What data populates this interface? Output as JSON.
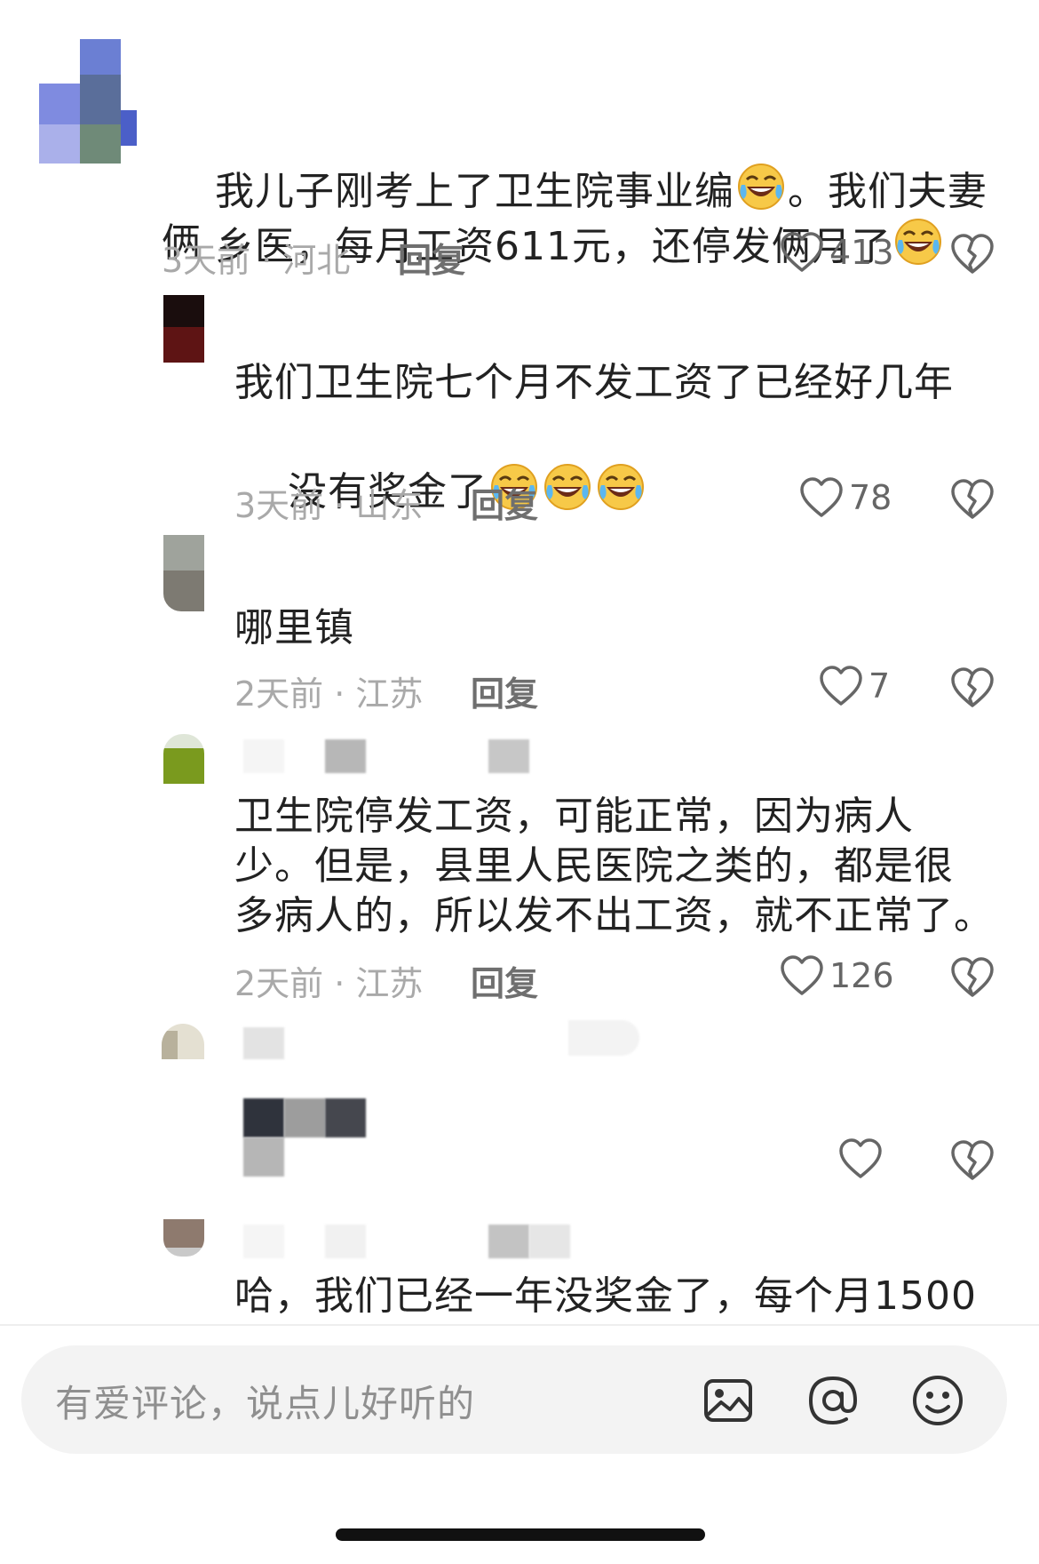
{
  "comments": [
    {
      "text_line1": "我儿子刚考上了卫生院事业编",
      "text_line1_after": "。我们夫妻俩",
      "text_line2": "乡医，每月工资611元，还停发俩月了",
      "time_location": "3天前 · 河北",
      "reply": "回复",
      "likes": "413"
    },
    {
      "text_line1": "我们卫生院七个月不发工资了已经好几年",
      "text_line2": "没有奖金了",
      "time_location": "3天前 · 山东",
      "reply": "回复",
      "likes": "78"
    },
    {
      "text_line1": "哪里镇",
      "time_location": "2天前 · 江苏",
      "reply": "回复",
      "likes": "7"
    },
    {
      "text_line1": "卫生院停发工资，可能正常，因为病人",
      "text_line2": "少。但是，县里人民医院之类的，都是很",
      "text_line3": "多病人的，所以发不出工资，就不正常了。",
      "time_location": "2天前 · 江苏",
      "reply": "回复",
      "likes": "126"
    },
    {
      "likes": ""
    },
    {
      "text_line1": "哈，我们已经一年没奖金了，每个月1500"
    }
  ],
  "input": {
    "placeholder": "有爱评论，说点儿好听的"
  },
  "icons": {
    "like": "heart-outline-icon",
    "dislike": "broken-heart-icon",
    "image": "image-icon",
    "mention": "at-icon",
    "emoji": "smiley-icon",
    "laughing_emoji": "rolling-on-floor-laughing-emoji"
  },
  "colors": {
    "meta": "#a9a9a9",
    "reply": "#6f6f6f",
    "input_bg": "#f3f3f3"
  }
}
